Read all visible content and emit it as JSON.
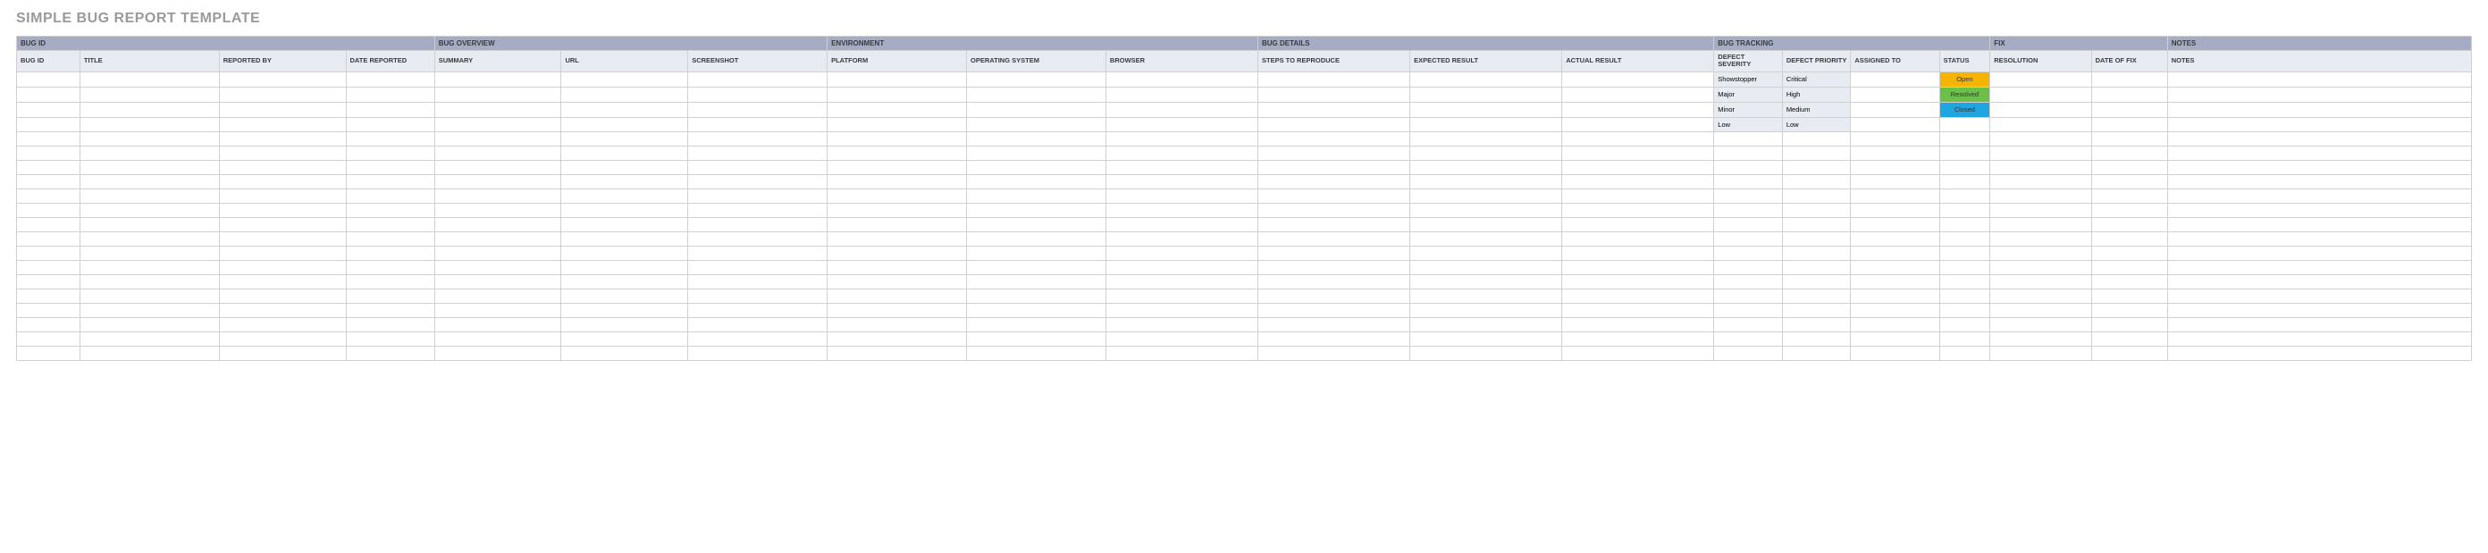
{
  "title": "SIMPLE BUG REPORT TEMPLATE",
  "groups": [
    {
      "label": "BUG ID",
      "span": 4
    },
    {
      "label": "BUG OVERVIEW",
      "span": 3
    },
    {
      "label": "ENVIRONMENT",
      "span": 3
    },
    {
      "label": "BUG DETAILS",
      "span": 3
    },
    {
      "label": "BUG TRACKING",
      "span": 4
    },
    {
      "label": "FIX",
      "span": 2
    },
    {
      "label": "NOTES",
      "span": 1
    }
  ],
  "columns": [
    "BUG ID",
    "TITLE",
    "REPORTED BY",
    "DATE REPORTED",
    "SUMMARY",
    "URL",
    "SCREENSHOT",
    "PLATFORM",
    "OPERATING SYSTEM",
    "BROWSER",
    "STEPS TO REPRODUCE",
    "EXPECTED RESULT",
    "ACTUAL RESULT",
    "DEFECT SEVERITY",
    "DEFECT PRIORITY",
    "ASSIGNED TO",
    "STATUS",
    "RESOLUTION",
    "DATE OF FIX",
    "NOTES"
  ],
  "severity_values": [
    "Showstopper",
    "Major",
    "Minor",
    "Low"
  ],
  "priority_values": [
    "Critical",
    "High",
    "Medium",
    "Low"
  ],
  "status_values": [
    {
      "label": "Open",
      "class": "status-open"
    },
    {
      "label": "Resolved",
      "class": "status-resolved"
    },
    {
      "label": "Closed",
      "class": "status-closed"
    }
  ],
  "empty_row_count": 20
}
